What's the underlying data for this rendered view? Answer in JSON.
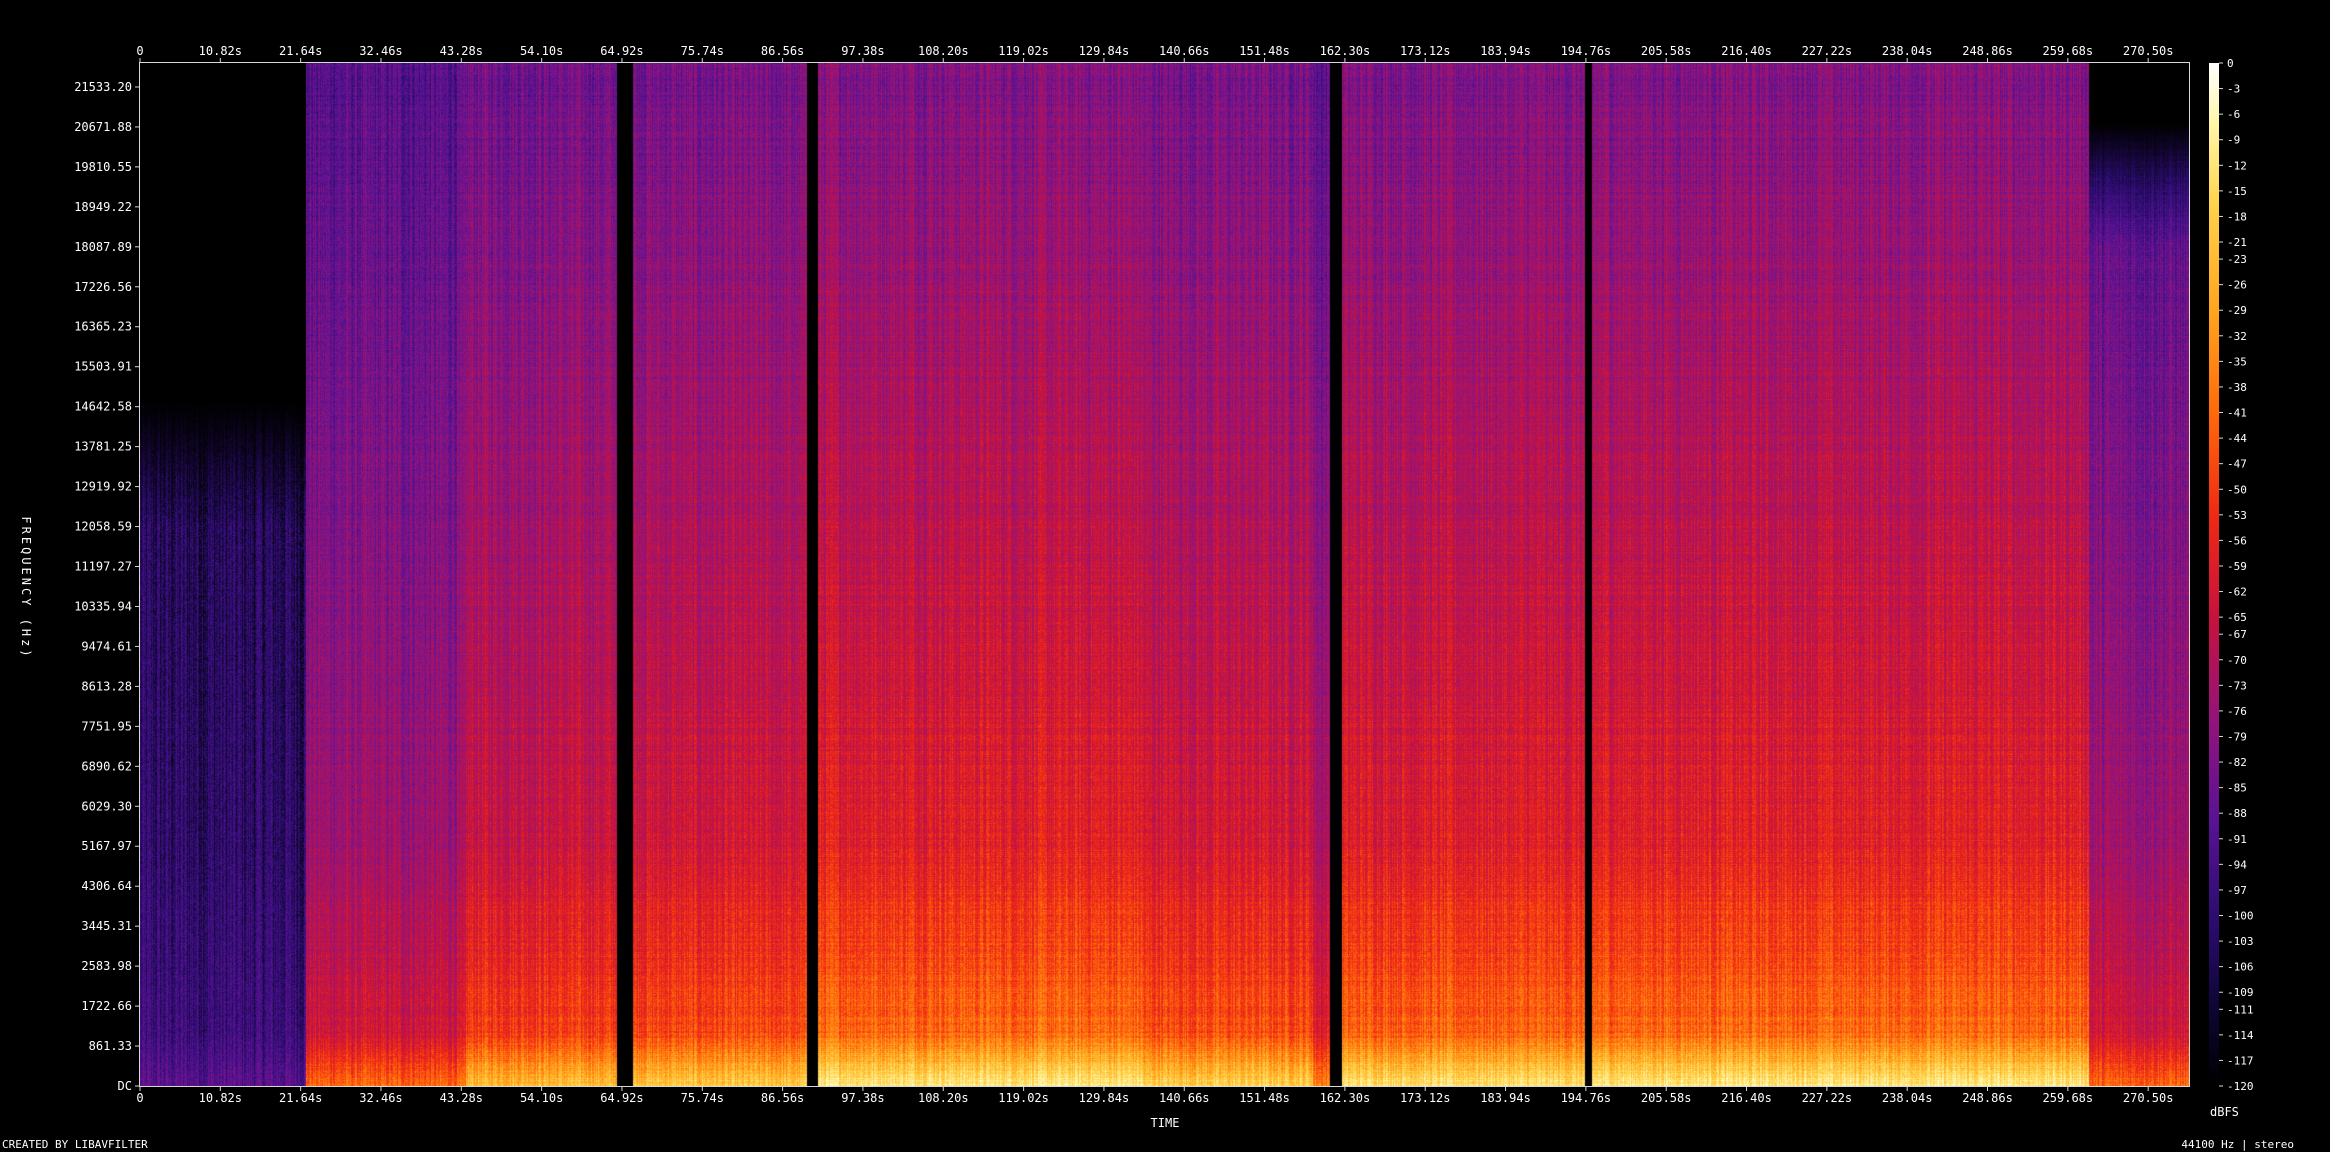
{
  "chart_data": {
    "type": "heatmap",
    "title": "",
    "xlabel": "TIME",
    "ylabel": "FREQUENCY (Hz)",
    "colorbar_label": "dBFS",
    "x_ticks": [
      "0",
      "10.82s",
      "21.64s",
      "32.46s",
      "43.28s",
      "54.10s",
      "64.92s",
      "75.74s",
      "86.56s",
      "97.38s",
      "108.20s",
      "119.02s",
      "129.84s",
      "140.66s",
      "151.48s",
      "162.30s",
      "173.12s",
      "183.94s",
      "194.76s",
      "205.58s",
      "216.40s",
      "227.22s",
      "238.04s",
      "248.86s",
      "259.68s",
      "270.50s"
    ],
    "x_range": [
      0,
      276.0
    ],
    "y_ticks": [
      "21533.20",
      "20671.88",
      "19810.55",
      "18949.22",
      "18087.89",
      "17226.56",
      "16365.23",
      "15503.91",
      "14642.58",
      "13781.25",
      "12919.92",
      "12058.59",
      "11197.27",
      "10335.94",
      "9474.61",
      "8613.28",
      "7751.95",
      "6890.62",
      "6029.30",
      "5167.97",
      "4306.64",
      "3445.31",
      "2583.98",
      "1722.66",
      "861.33",
      "DC"
    ],
    "y_range": [
      0,
      22050
    ],
    "colorbar_ticks": [
      "0",
      "-3",
      "-6",
      "-9",
      "-12",
      "-15",
      "-18",
      "-21",
      "-23",
      "-26",
      "-29",
      "-32",
      "-35",
      "-38",
      "-41",
      "-44",
      "-47",
      "-50",
      "-53",
      "-56",
      "-59",
      "-62",
      "-65",
      "-67",
      "-70",
      "-73",
      "-76",
      "-79",
      "-82",
      "-85",
      "-88",
      "-91",
      "-94",
      "-97",
      "-100",
      "-103",
      "-106",
      "-109",
      "-111",
      "-114",
      "-117",
      "-120"
    ],
    "colorbar_range": [
      0,
      -120
    ],
    "colorscale": [
      "#000000",
      "#2a0c6e",
      "#5a1294",
      "#94137a",
      "#c8123c",
      "#f02a14",
      "#ff6a0a",
      "#ffa61e",
      "#ffd24a",
      "#fff6a8",
      "#ffffff"
    ],
    "segments": [
      {
        "start": 0.0,
        "end": 22.3,
        "level": 0.18,
        "top_hz": 12000
      },
      {
        "start": 22.3,
        "end": 43.8,
        "level": 0.55,
        "top_hz": 22050
      },
      {
        "start": 43.8,
        "end": 64.5,
        "level": 0.7,
        "top_hz": 22050
      },
      {
        "start": 66.3,
        "end": 89.8,
        "level": 0.72,
        "top_hz": 22050
      },
      {
        "start": 91.2,
        "end": 135.0,
        "level": 0.8,
        "top_hz": 22050
      },
      {
        "start": 135.0,
        "end": 158.0,
        "level": 0.74,
        "top_hz": 22050
      },
      {
        "start": 158.0,
        "end": 160.2,
        "level": 0.6,
        "top_hz": 22050
      },
      {
        "start": 161.8,
        "end": 194.6,
        "level": 0.78,
        "top_hz": 22050
      },
      {
        "start": 195.5,
        "end": 262.5,
        "level": 0.8,
        "top_hz": 22050
      },
      {
        "start": 262.5,
        "end": 276.0,
        "level": 0.55,
        "top_hz": 18000
      }
    ],
    "silence_gaps": [
      64.7,
      90.4,
      160.9,
      195.0
    ]
  },
  "footer": {
    "credit": "CREATED BY LIBAVFILTER",
    "format": "44100 Hz | stereo"
  }
}
